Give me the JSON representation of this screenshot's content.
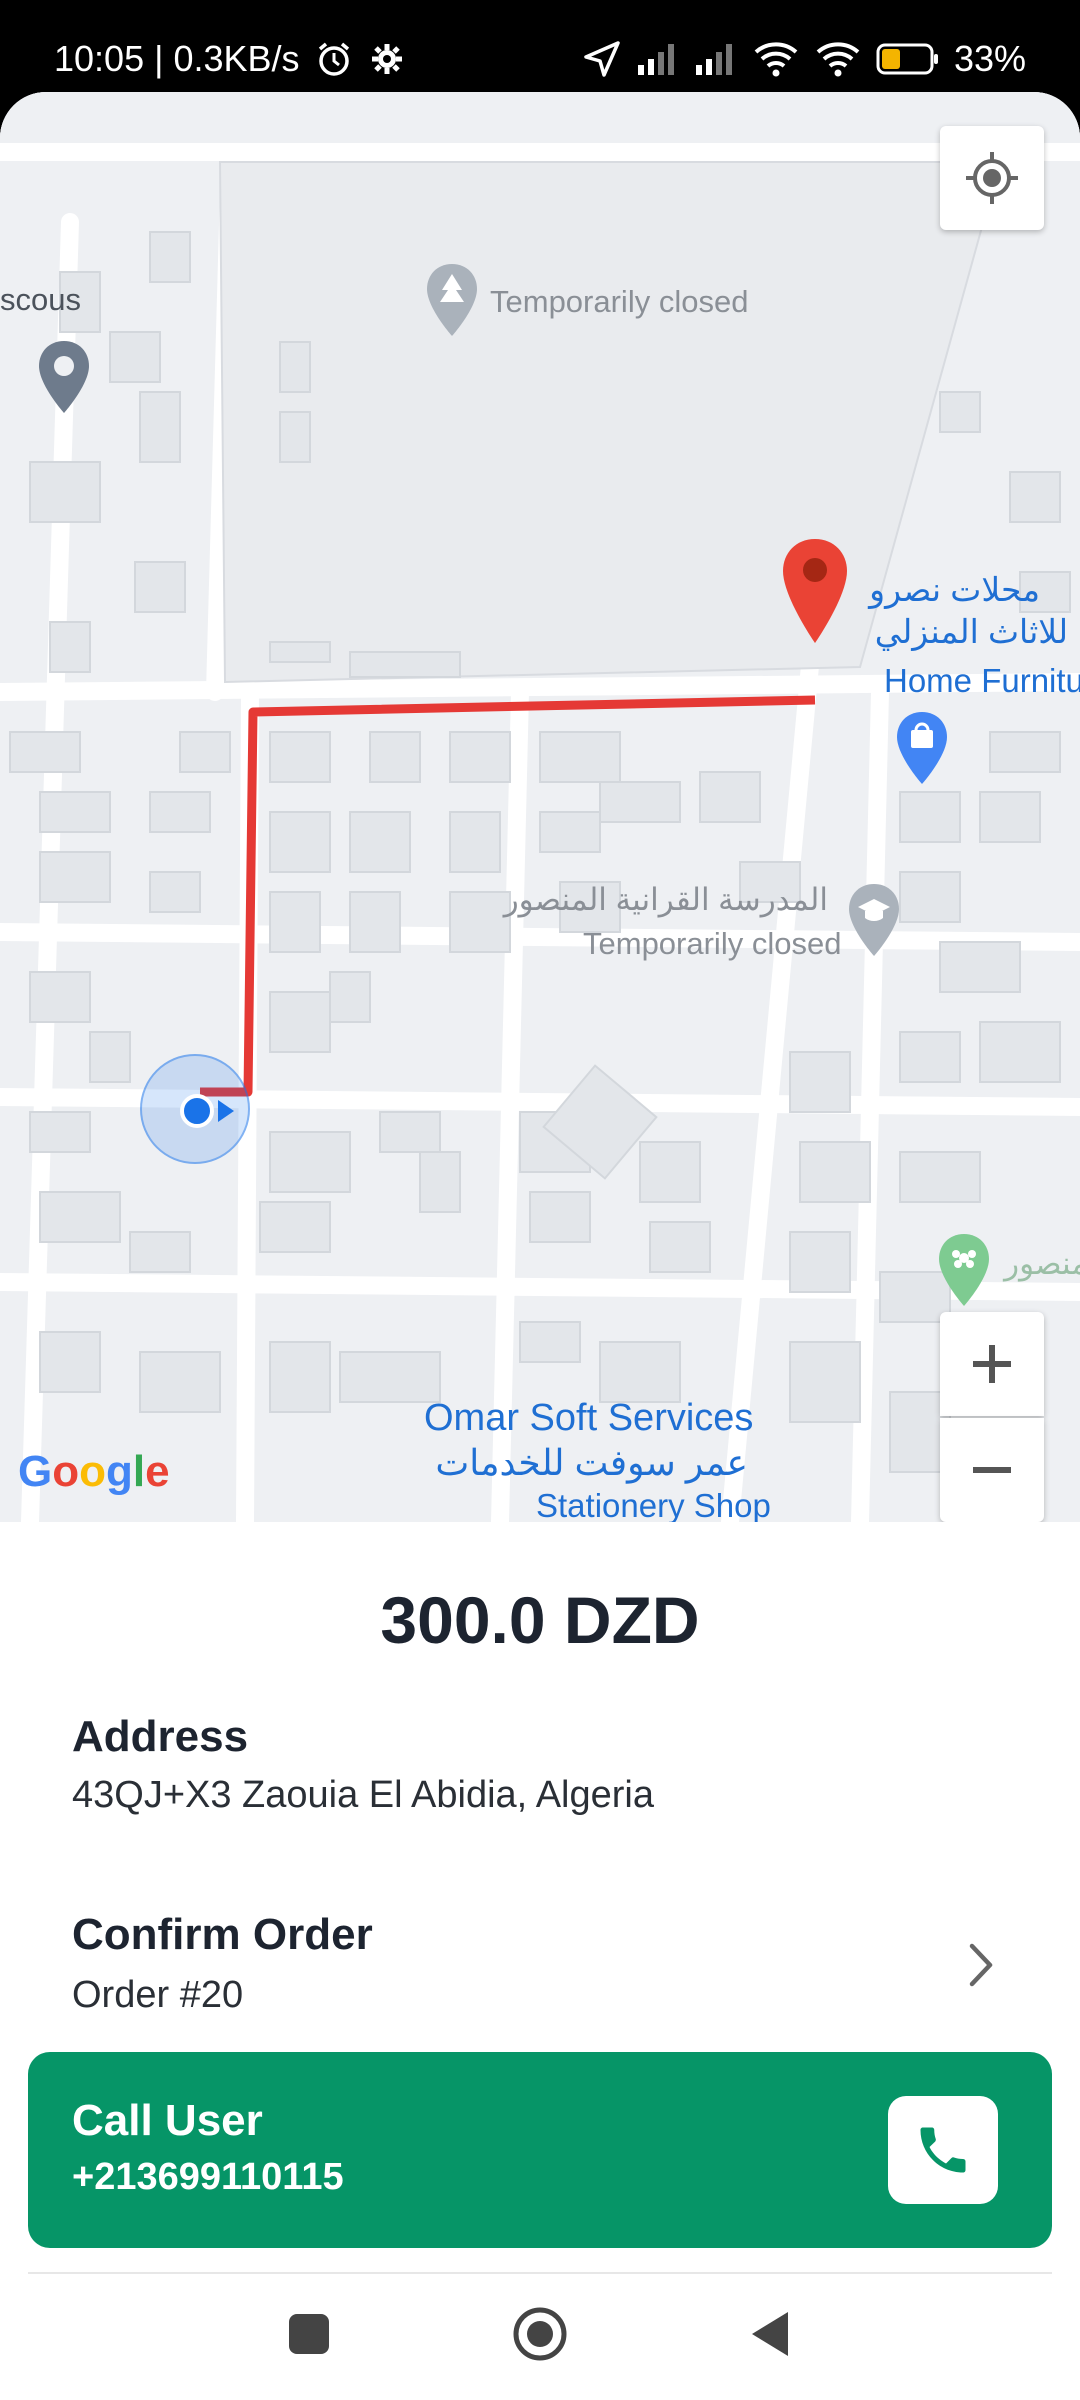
{
  "status_bar": {
    "time_speed": "10:05 | 0.3KB/s",
    "battery": "33%",
    "icons": [
      "alarm-icon",
      "gear-icon",
      "navigation-arrow-icon",
      "signal-icon",
      "signal-icon",
      "wifi-icon",
      "wifi-icon",
      "battery-icon"
    ]
  },
  "map": {
    "labels": {
      "scous": "scous",
      "temp_closed_top": "Temporarily closed",
      "ar_shop_line1": "محلات نصرو",
      "ar_shop_line2": "للاثاث المنزلي",
      "home_furniture": "Home Furniture",
      "ar_school": "المدرسة القرانية المنصور",
      "temp_closed_mid": "Temporarily closed",
      "omar_soft": "Omar Soft Services",
      "ar_omar": "عمر سوفت للخدمات",
      "stationery": "Stationery Shop",
      "right_edge_ar": "منصور"
    },
    "google_logo": "Google",
    "colors": {
      "route": "#e53935",
      "destination_pin": "#ea4335",
      "user_dot": "#1a73e8"
    }
  },
  "order": {
    "price": "300.0 DZD",
    "address_title": "Address",
    "address_value": "43QJ+X3 Zaouia El Abidia, Algeria",
    "confirm_title": "Confirm Order",
    "order_number": "Order #20",
    "call_title": "Call User",
    "call_number": "+213699110115",
    "accent_color": "#069567"
  }
}
